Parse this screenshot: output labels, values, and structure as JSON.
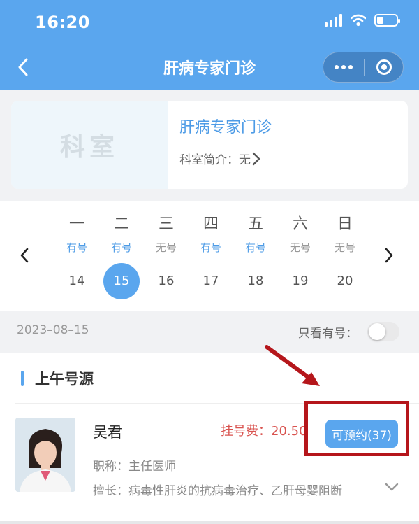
{
  "status_bar": {
    "time": "16:20"
  },
  "nav": {
    "title": "肝病专家门诊",
    "back_icon": "chevron-left-icon",
    "more_icon": "more-dots-icon",
    "close_icon": "target-circle-icon"
  },
  "department": {
    "thumb_text": "科室",
    "name": "肝病专家门诊",
    "intro_label": "科室简介：无"
  },
  "calendar": {
    "days": [
      {
        "weekday": "一",
        "availability": "有号",
        "date": "14",
        "available": true,
        "selected": false
      },
      {
        "weekday": "二",
        "availability": "有号",
        "date": "15",
        "available": true,
        "selected": true
      },
      {
        "weekday": "三",
        "availability": "无号",
        "date": "16",
        "available": false,
        "selected": false
      },
      {
        "weekday": "四",
        "availability": "有号",
        "date": "17",
        "available": true,
        "selected": false
      },
      {
        "weekday": "五",
        "availability": "有号",
        "date": "18",
        "available": true,
        "selected": false
      },
      {
        "weekday": "六",
        "availability": "无号",
        "date": "19",
        "available": false,
        "selected": false
      },
      {
        "weekday": "日",
        "availability": "无号",
        "date": "20",
        "available": false,
        "selected": false
      }
    ]
  },
  "filter": {
    "selected_date": "2023–08–15",
    "only_available_label": "只看有号：",
    "only_available_on": false
  },
  "morning": {
    "section_title": "上午号源",
    "doctor": {
      "name": "吴君",
      "fee_label": "挂号费：20.50",
      "book_button": "可预约(37)",
      "title": "职称：主任医师",
      "specialty": "擅长：病毒性肝炎的抗病毒治疗、乙肝母婴阻断"
    }
  },
  "colors": {
    "header": "#5aa6ee",
    "accent": "#4d9be6",
    "fee": "#d9534f",
    "annotation": "#b5161b"
  }
}
